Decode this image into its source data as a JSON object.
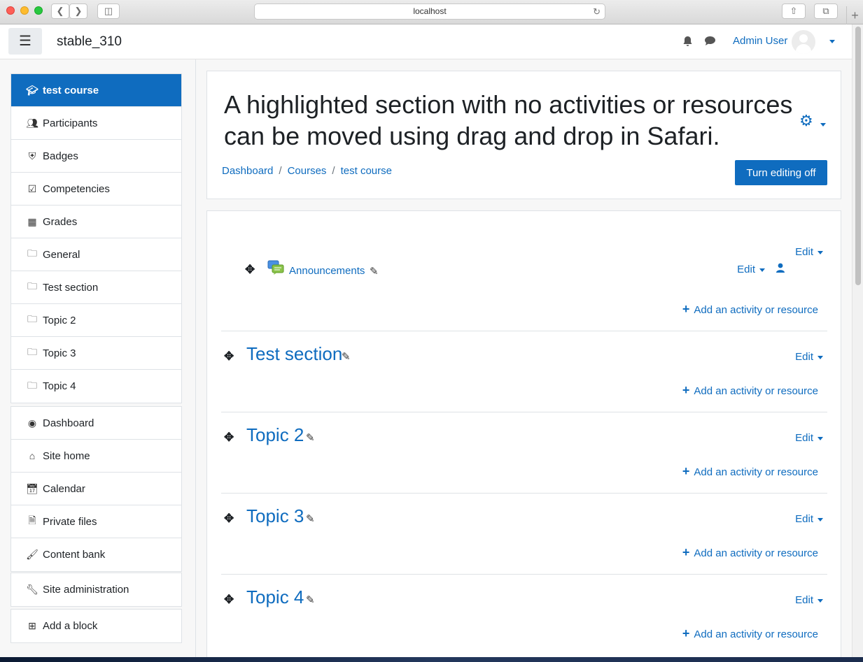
{
  "browser": {
    "url": "localhost",
    "back_icon": "chevron-left-icon",
    "forward_icon": "chevron-right-icon"
  },
  "navbar": {
    "site_name": "stable_310",
    "user_name": "Admin User",
    "menu_icon": "hamburger-icon"
  },
  "drawer": {
    "course_items": [
      {
        "label": "test course",
        "icon": "graduation-cap-icon",
        "active": true
      },
      {
        "label": "Participants",
        "icon": "users-icon"
      },
      {
        "label": "Badges",
        "icon": "shield-icon"
      },
      {
        "label": "Competencies",
        "icon": "checkbox-icon"
      },
      {
        "label": "Grades",
        "icon": "table-icon"
      },
      {
        "label": "General",
        "icon": "folder-icon"
      },
      {
        "label": "Test section",
        "icon": "folder-icon"
      },
      {
        "label": "Topic 2",
        "icon": "folder-icon"
      },
      {
        "label": "Topic 3",
        "icon": "folder-icon"
      },
      {
        "label": "Topic 4",
        "icon": "folder-icon"
      }
    ],
    "site_items": [
      {
        "label": "Dashboard",
        "icon": "dashboard-icon"
      },
      {
        "label": "Site home",
        "icon": "home-icon"
      },
      {
        "label": "Calendar",
        "icon": "calendar-icon"
      },
      {
        "label": "Private files",
        "icon": "file-icon"
      },
      {
        "label": "Content bank",
        "icon": "paintbrush-icon"
      }
    ],
    "admin_items": [
      {
        "label": "Site administration",
        "icon": "wrench-icon"
      }
    ],
    "block_items": [
      {
        "label": "Add a block",
        "icon": "plus-square-icon"
      }
    ]
  },
  "header": {
    "title": "A highlighted section with no activities or resources can be moved using drag and drop in Safari.",
    "breadcrumb": [
      "Dashboard",
      "Courses",
      "test course"
    ],
    "edit_toggle_label": "Turn editing off"
  },
  "content": {
    "edit_label": "Edit",
    "add_activity_label": "Add an activity or resource",
    "general_section": {
      "activity_name": "Announcements"
    },
    "sections": [
      {
        "title": "Test section"
      },
      {
        "title": "Topic 2"
      },
      {
        "title": "Topic 3"
      },
      {
        "title": "Topic 4"
      }
    ]
  },
  "colors": {
    "accent": "#0f6cbf",
    "text": "#1d2125",
    "border": "#dee2e6"
  }
}
